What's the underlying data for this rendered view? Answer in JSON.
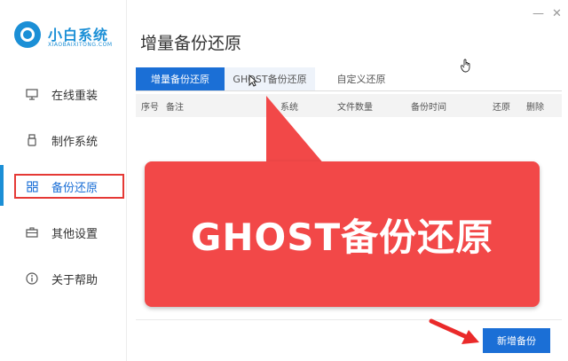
{
  "app": {
    "name": "小白系统",
    "subtitle": "XIAOBAIXITONG.COM",
    "brand_color": "#1b8fd6",
    "window_controls": {
      "minimize": "—",
      "close": "✕"
    }
  },
  "sidebar": {
    "items": [
      {
        "label": "在线重装",
        "icon": "monitor-icon"
      },
      {
        "label": "制作系统",
        "icon": "usb-icon"
      },
      {
        "label": "备份还原",
        "icon": "grid-icon",
        "active": true
      },
      {
        "label": "其他设置",
        "icon": "toolbox-icon"
      },
      {
        "label": "关于帮助",
        "icon": "info-icon"
      }
    ]
  },
  "main": {
    "title": "增量备份还原",
    "tabs": [
      {
        "label": "增量备份还原",
        "active": true
      },
      {
        "label": "GHOST备份还原"
      },
      {
        "label": "自定义还原"
      }
    ],
    "table_headers": [
      "序号",
      "备注",
      "系统",
      "文件数量",
      "备份时间",
      "还原",
      "删除"
    ],
    "new_backup_label": "新增备份"
  },
  "callout": {
    "text": "GHOST备份还原",
    "color": "#f24848"
  },
  "accent_color": "#1b6fd6",
  "highlight_color": "#e53935"
}
